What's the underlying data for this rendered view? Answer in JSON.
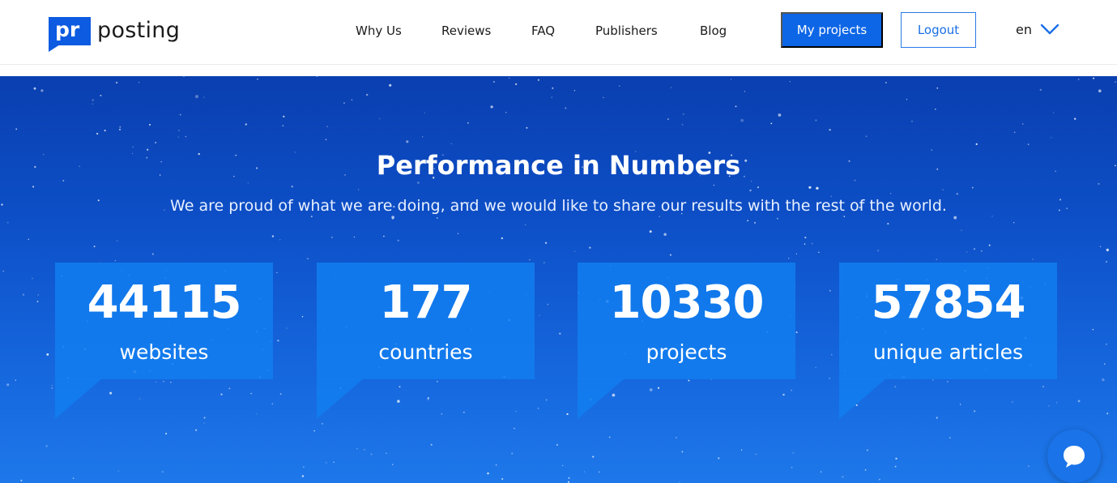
{
  "header": {
    "logo": {
      "mark": "pr",
      "text": "posting"
    },
    "nav": [
      {
        "label": "Why Us"
      },
      {
        "label": "Reviews"
      },
      {
        "label": "FAQ"
      },
      {
        "label": "Publishers"
      },
      {
        "label": "Blog"
      }
    ],
    "my_projects_label": "My projects",
    "logout_label": "Logout",
    "language": "en",
    "language_icon": "chevron-down-icon"
  },
  "hero": {
    "title": "Performance in Numbers",
    "subtitle": "We are proud of what we are doing, and we would like to share our results with the rest of the world.",
    "stats": [
      {
        "value": "44115",
        "label": "websites"
      },
      {
        "value": "177",
        "label": "countries"
      },
      {
        "value": "10330",
        "label": "projects"
      },
      {
        "value": "57854",
        "label": "unique articles"
      }
    ]
  },
  "chat": {
    "icon": "chat-bubble-icon"
  },
  "colors": {
    "brand": "#0c5be0",
    "primary_button": "#0d66e6",
    "hero_top": "#0a3fb0",
    "hero_bottom": "#1e78ea",
    "stat_box": "#127ef0"
  }
}
